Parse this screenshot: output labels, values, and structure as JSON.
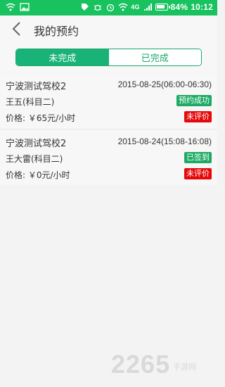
{
  "status_bar": {
    "network_label": "4G",
    "battery_percent": "84%",
    "time": "10:12",
    "icons": [
      "wifi-icon",
      "image-icon",
      "tag-icon",
      "bug-icon",
      "alarm-icon",
      "wifi-icon",
      "signal-icon",
      "battery-icon"
    ]
  },
  "appbar": {
    "back_icon": "chevron-left-icon",
    "title": "我的预约"
  },
  "tabs": [
    {
      "label": "未完成",
      "active": true
    },
    {
      "label": "已完成",
      "active": false
    }
  ],
  "appointments": [
    {
      "school": "宁波测试驾校2",
      "time": "2015-08-25(06:00-06:30)",
      "coach": "王五(科目二)",
      "status_badge": "预约成功",
      "price": "价格: ￥65元/小时",
      "review_badge": "未评价"
    },
    {
      "school": "宁波测试驾校2",
      "time": "2015-08-24(15:08-16:08)",
      "coach": "王大雷(科目二)",
      "status_badge": "已签到",
      "price": "价格: ￥0元/小时",
      "review_badge": "未评价"
    }
  ],
  "watermark": {
    "number": "2265",
    "text": "手游网"
  },
  "colors": {
    "status_bar_bg": "#18c25e",
    "tab_active_bg": "#19b277",
    "badge_green": "#1daa64",
    "badge_red": "#e50909"
  }
}
